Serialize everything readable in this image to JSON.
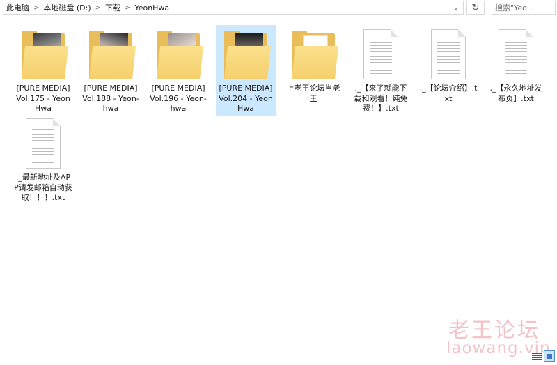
{
  "toolbar": {
    "breadcrumb": [
      "此电脑",
      "本地磁盘 (D:)",
      "下载",
      "YeonHwa"
    ],
    "separator": ">",
    "dropdown_glyph": "⌄",
    "refresh_glyph": "↻",
    "search_placeholder": "搜索\"Yeo..."
  },
  "items": [
    {
      "type": "folder",
      "label": "[PURE MEDIA] Vol.175 - YeonHwa",
      "selected": false
    },
    {
      "type": "folder",
      "label": "[PURE MEDIA] Vol.188 - Yeon-hwa",
      "selected": false
    },
    {
      "type": "folder",
      "label": "[PURE MEDIA] Vol.196 - Yeon-hwa",
      "selected": false
    },
    {
      "type": "folder",
      "label": "[PURE MEDIA] Vol.204 - YeonHwa",
      "selected": true
    },
    {
      "type": "folder",
      "label": "上老王论坛当老王",
      "selected": false
    },
    {
      "type": "txt",
      "label": "._【来了就能下载和观看！纯免费！】.txt",
      "selected": false
    },
    {
      "type": "txt",
      "label": "._【论坛介绍】.txt",
      "selected": false
    },
    {
      "type": "txt",
      "label": "._【永久地址发布页】.txt",
      "selected": false
    },
    {
      "type": "txt",
      "label": "._最新地址及APP请发邮箱自动获取！！！.txt",
      "selected": false
    }
  ],
  "watermark": {
    "cn": "老王论坛",
    "en": "laowang.vip"
  },
  "colors": {
    "selection": "#cce8ff",
    "folder": "#f5cf6b",
    "watermark": "#f2c3c8"
  },
  "icons": {
    "folder": "folder-icon",
    "txt": "text-file-icon",
    "refresh": "refresh-icon",
    "dropdown": "chevron-down-icon"
  }
}
